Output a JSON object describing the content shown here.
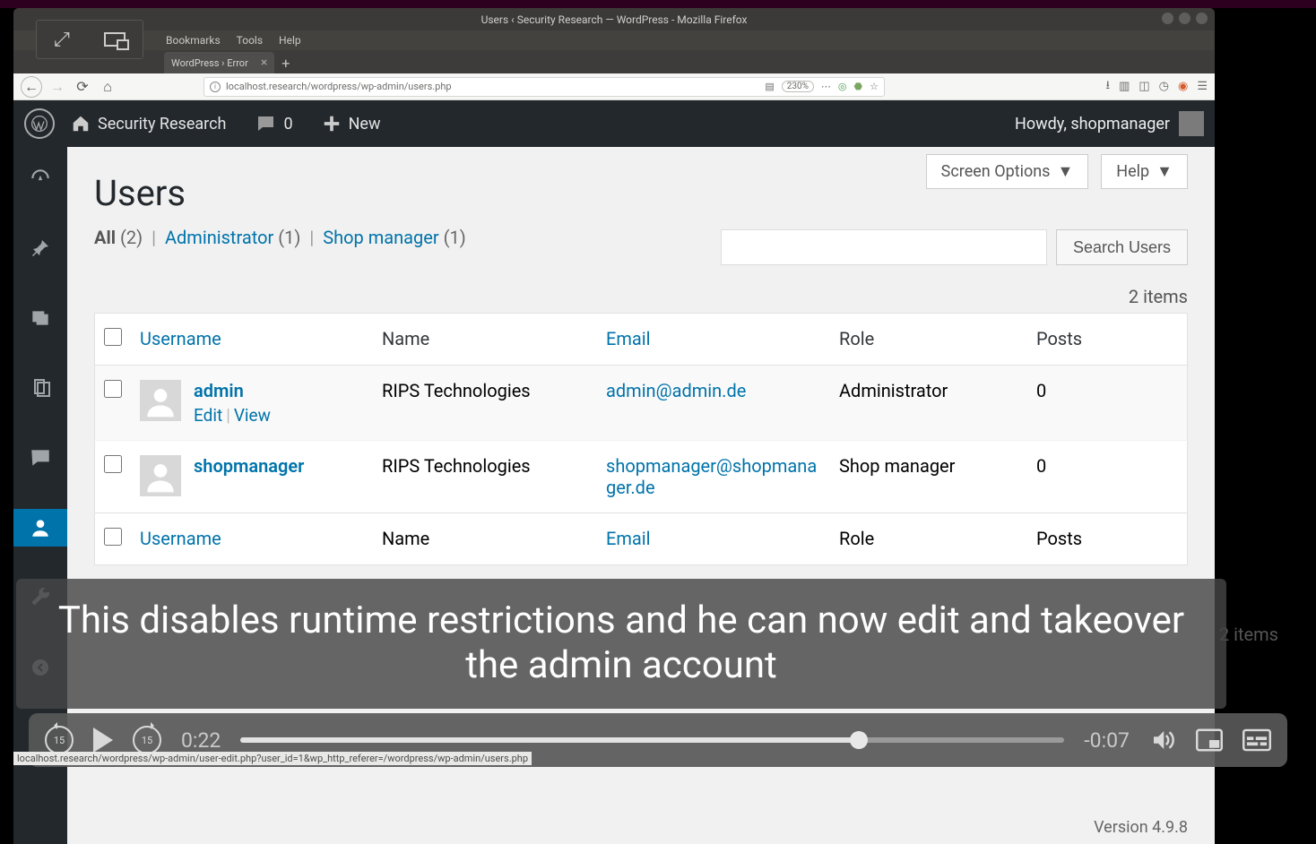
{
  "browser": {
    "window_title": "Users ‹ Security Research — WordPress - Mozilla Firefox",
    "menubar": [
      "Bookmarks",
      "Tools",
      "Help"
    ],
    "tab_title": "WordPress › Error",
    "url": "localhost.research/wordpress/wp-admin/users.php",
    "zoom": "230%",
    "status_link": "localhost.research/wordpress/wp-admin/user-edit.php?user_id=1&wp_http_referer=/wordpress/wp-admin/users.php"
  },
  "adminbar": {
    "site_name": "Security Research",
    "comments_count": "0",
    "new_label": "New",
    "howdy": "Howdy, shopmanager"
  },
  "page": {
    "title": "Users",
    "screen_options": "Screen Options",
    "help": "Help",
    "filters": {
      "all_label": "All",
      "all_count": "(2)",
      "admin_label": "Administrator",
      "admin_count": "(1)",
      "shop_label": "Shop manager",
      "shop_count": "(1)"
    },
    "search_btn": "Search Users",
    "item_count_top": "2 items",
    "item_count_bottom": "2 items",
    "columns": {
      "username": "Username",
      "name": "Name",
      "email": "Email",
      "role": "Role",
      "posts": "Posts"
    },
    "rows": [
      {
        "username": "admin",
        "name": "RIPS Technologies",
        "email": "admin@admin.de",
        "role": "Administrator",
        "posts": "0",
        "actions": {
          "edit": "Edit",
          "view": "View"
        }
      },
      {
        "username": "shopmanager",
        "name": "RIPS Technologies",
        "email": "shopmanager@shopmanager.de",
        "role": "Shop manager",
        "posts": "0"
      }
    ],
    "version": "Version 4.9.8"
  },
  "caption": "This disables runtime restrictions and he can now edit and takeover the admin account",
  "video": {
    "skip": "15",
    "elapsed": "0:22",
    "remaining": "-0:07"
  }
}
